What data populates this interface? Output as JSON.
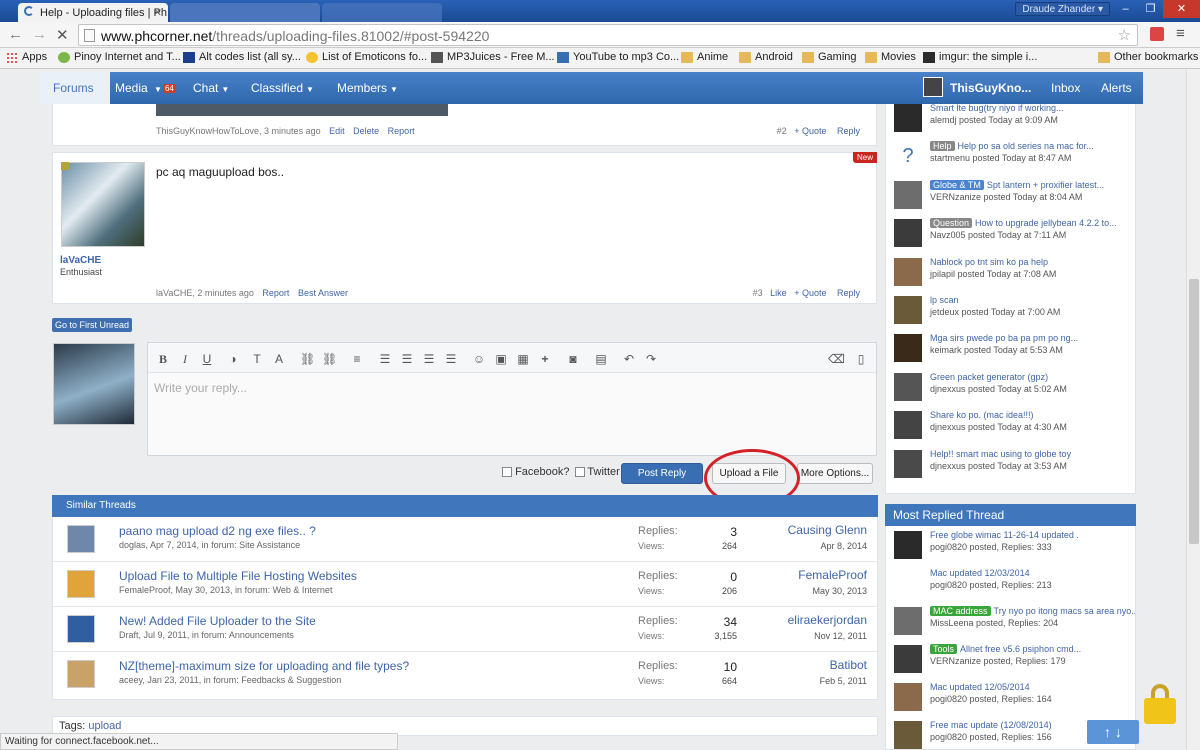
{
  "browser": {
    "tabs": [
      {
        "title": "Help - Uploading files | Ph"
      },
      {
        "title": ""
      }
    ],
    "profile": "Draude Zhander",
    "url_domain": "www.phcorner.net",
    "url_path": "/threads/uploading-files.81002/#post-594220",
    "bookmarks": [
      "Apps",
      "Pinoy Internet and T...",
      "Alt codes list (all sy...",
      "List of Emoticons fo...",
      "MP3Juices - Free M...",
      "YouTube to mp3 Co...",
      "Anime",
      "Android",
      "Gaming",
      "Movies",
      "imgur: the simple i...",
      "Other bookmarks"
    ],
    "status": "Waiting for connect.facebook.net..."
  },
  "nav": {
    "forums": "Forums",
    "media": "Media",
    "media_badge": "64",
    "chat": "Chat",
    "classified": "Classified",
    "members": "Members",
    "user": "ThisGuyKno...",
    "inbox": "Inbox",
    "alerts": "Alerts"
  },
  "post2": {
    "meta": "ThisGuyKnowHowToLove, 3 minutes ago",
    "edit": "Edit",
    "delete": "Delete",
    "report": "Report",
    "num": "#2",
    "quote": "+ Quote",
    "reply": "Reply"
  },
  "post3": {
    "new": "New",
    "text": "pc aq maguupload bos..",
    "user": "laVaCHE",
    "rank": "Enthusiast",
    "meta": "laVaCHE, 2 minutes ago",
    "report": "Report",
    "best": "Best Answer",
    "num": "#3",
    "like": "Like",
    "quote": "+ Quote",
    "reply": "Reply"
  },
  "go_unread": "Go to First Unread",
  "editor": {
    "placeholder": "Write your reply...",
    "facebook": "Facebook?",
    "twitter": "Twitter",
    "post": "Post Reply",
    "upload": "Upload a File",
    "more": "More Options..."
  },
  "similar": {
    "header": "Similar Threads",
    "replies_label": "Replies:",
    "views_label": "Views:",
    "rows": [
      {
        "title": "paano mag upload d2 ng exe files.. ?",
        "sub": "doglas, Apr 7, 2014, in forum: Site Assistance",
        "replies": "3",
        "views": "264",
        "user": "Causing Glenn",
        "date": "Apr 8, 2014"
      },
      {
        "title": "Upload File to Multiple File Hosting Websites",
        "sub": "FemaleProof, May 30, 2013, in forum: Web & Internet",
        "replies": "0",
        "views": "206",
        "user": "FemaleProof",
        "date": "May 30, 2013"
      },
      {
        "title": "New! Added File Uploader to the Site",
        "sub": "Draft, Jul 9, 2011, in forum: Announcements",
        "replies": "34",
        "views": "3,155",
        "user": "eliraekerjordan",
        "date": "Nov 12, 2011"
      },
      {
        "title": "NZ[theme]-maximum size for uploading and file types?",
        "sub": "aceey, Jan 23, 2011, in forum: Feedbacks & Suggestion",
        "replies": "10",
        "views": "664",
        "user": "Batibot",
        "date": "Feb 5, 2011"
      }
    ]
  },
  "tags": {
    "label": "Tags:",
    "tag": "upload"
  },
  "sidebar_new": [
    {
      "prefix": "",
      "title": "Smart lte bug(try niyo if working...",
      "meta": "alemdj posted Today at 9:09 AM"
    },
    {
      "prefix": "Help",
      "title": "Help po sa old series na mac for...",
      "meta": "startmenu posted Today at 8:47 AM"
    },
    {
      "prefix": "Globe & TM",
      "title": "Spt lantern + proxifier latest...",
      "meta": "VERNzanize posted Today at 8:04 AM"
    },
    {
      "prefix": "Question",
      "title": "How to upgrade jellybean 4.2.2 to...",
      "meta": "Navz005 posted Today at 7:11 AM"
    },
    {
      "prefix": "",
      "title": "Nablock po tnt sim ko pa help",
      "meta": "jpilapil posted Today at 7:08 AM"
    },
    {
      "prefix": "",
      "title": "lp scan",
      "meta": "jetdeux posted Today at 7:00 AM"
    },
    {
      "prefix": "",
      "title": "Mga sirs pwede po ba pa pm po ng...",
      "meta": "keimark posted Today at 5:53 AM"
    },
    {
      "prefix": "",
      "title": "Green packet generator (gpz)",
      "meta": "djnexxus posted Today at 5:02 AM"
    },
    {
      "prefix": "",
      "title": "Share ko po. (mac idea!!!)",
      "meta": "djnexxus posted Today at 4:30 AM"
    },
    {
      "prefix": "",
      "title": "Help!! smart mac using to globe toy",
      "meta": "djnexxus posted Today at 3:53 AM"
    }
  ],
  "most_replied": {
    "header": "Most Replied Thread",
    "items": [
      {
        "prefix": "",
        "title": "Free globe wimac 11-26-14 updated .",
        "meta": "pogi0820 posted, Replies: 333"
      },
      {
        "prefix": "",
        "title": "Mac updated 12/03/2014",
        "meta": "pogi0820 posted, Replies: 213"
      },
      {
        "prefix": "MAC address",
        "title": "Try nyo po itong macs sa area nyo...",
        "meta": "MissLeena posted, Replies: 204"
      },
      {
        "prefix": "Tools",
        "title": "Allnet free v5.6 psiphon cmd...",
        "meta": "VERNzanize posted, Replies: 179"
      },
      {
        "prefix": "",
        "title": "Mac updated 12/05/2014",
        "meta": "pogi0820 posted, Replies: 164"
      },
      {
        "prefix": "",
        "title": "Free mac update (12/08/2014)",
        "meta": "pogi0820 posted, Replies: 156"
      }
    ]
  },
  "colors": {
    "brand": "#3f78c0",
    "link": "#3f65a7",
    "highlight_circle": "#d42027"
  },
  "icons": [
    "back-icon",
    "forward-icon",
    "reload-icon",
    "star-icon",
    "lock-icon",
    "scroll-top-icon"
  ]
}
